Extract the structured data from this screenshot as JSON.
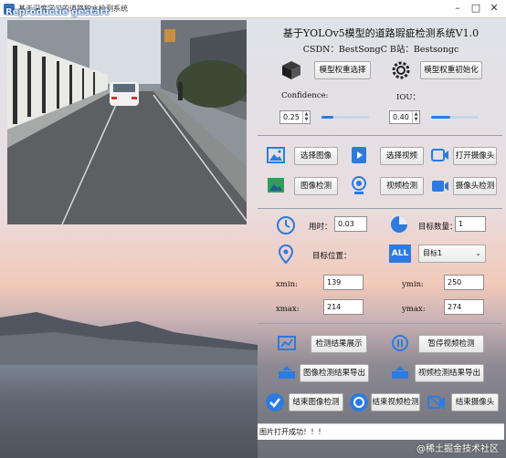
{
  "window": {
    "title": "基于深度学习的道路积水检测系统",
    "overlay_text": "Reproductie gestart"
  },
  "header": {
    "title": "基于YOLOv5模型的道路瑕疵检测系统V1.0",
    "subtitle": "CSDN：BestSongC   B站：Bestsongc"
  },
  "model": {
    "select_label": "模型权重选择",
    "init_label": "模型权重初始化"
  },
  "params": {
    "confidence_label": "Confidence:",
    "confidence_value": "0.25",
    "confidence_level": 0.25,
    "iou_label": "IOU：",
    "iou_value": "0.40",
    "iou_level": 0.4
  },
  "input_buttons": {
    "select_image": "选择图像",
    "select_video": "选择视频",
    "open_camera": "打开摄像头",
    "image_detect": "图像检测",
    "video_detect": "视频检测",
    "camera_detect": "摄像头检测"
  },
  "results": {
    "time_label": "用时：",
    "time_value": "0.03",
    "count_label": "目标数量：",
    "count_value": "1",
    "position_label": "目标位置：",
    "target_option": "目标1",
    "all_badge": "ALL",
    "xmin_label": "xmin:",
    "xmin_value": "139",
    "ymin_label": "ymin:",
    "ymin_value": "250",
    "xmax_label": "xmax:",
    "xmax_value": "214",
    "ymax_label": "ymax:",
    "ymax_value": "274"
  },
  "actions": {
    "show_result": "检测结果展示",
    "pause_video": "暂停视频检测",
    "export_image": "图像检测结果导出",
    "export_video": "视频检测结果导出",
    "end_image": "结束图像检测",
    "end_video": "结束视频检测",
    "end_camera": "结束摄像头"
  },
  "status": {
    "message": "图片打开成功！！！"
  },
  "watermark": "@稀土掘金技术社区",
  "colors": {
    "accent": "#2d7be0",
    "separator": "#9aa0aa"
  }
}
